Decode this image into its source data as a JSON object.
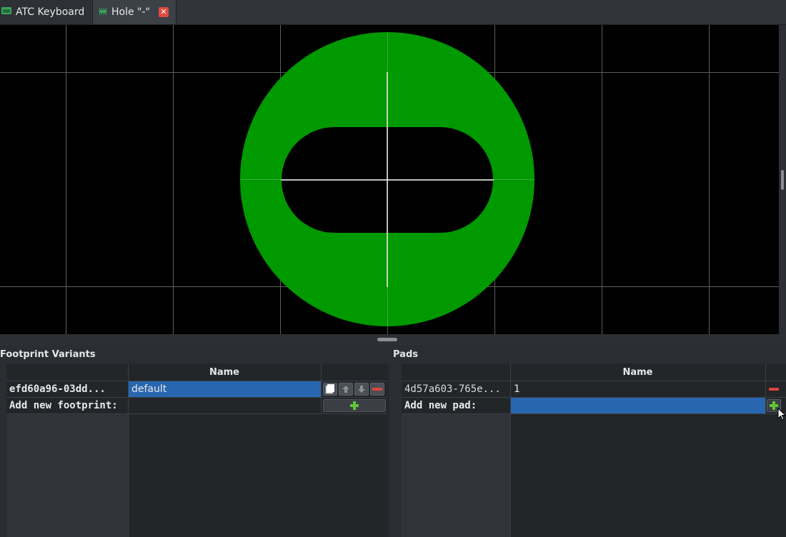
{
  "tabs": [
    {
      "label": "ATC Keyboard",
      "icon": "library-icon"
    },
    {
      "label": "Hole \"-\"",
      "icon": "component-icon",
      "close_icon": "close-icon"
    }
  ],
  "canvas": {
    "background": "#000000",
    "pad_color": "#009900",
    "grid_color": "#666666",
    "crosshair_color": "#ffffff"
  },
  "footprints": {
    "title": "Footprint Variants",
    "column_name": "Name",
    "rows": [
      {
        "uuid": "efd60a96-03dd...",
        "name": "default"
      }
    ],
    "add_label": "Add new footprint:",
    "add_value": ""
  },
  "pads": {
    "title": "Pads",
    "column_name": "Name",
    "rows": [
      {
        "uuid": "4d57a603-765e...",
        "name": "1"
      }
    ],
    "add_label": "Add new pad:",
    "add_value": ""
  }
}
